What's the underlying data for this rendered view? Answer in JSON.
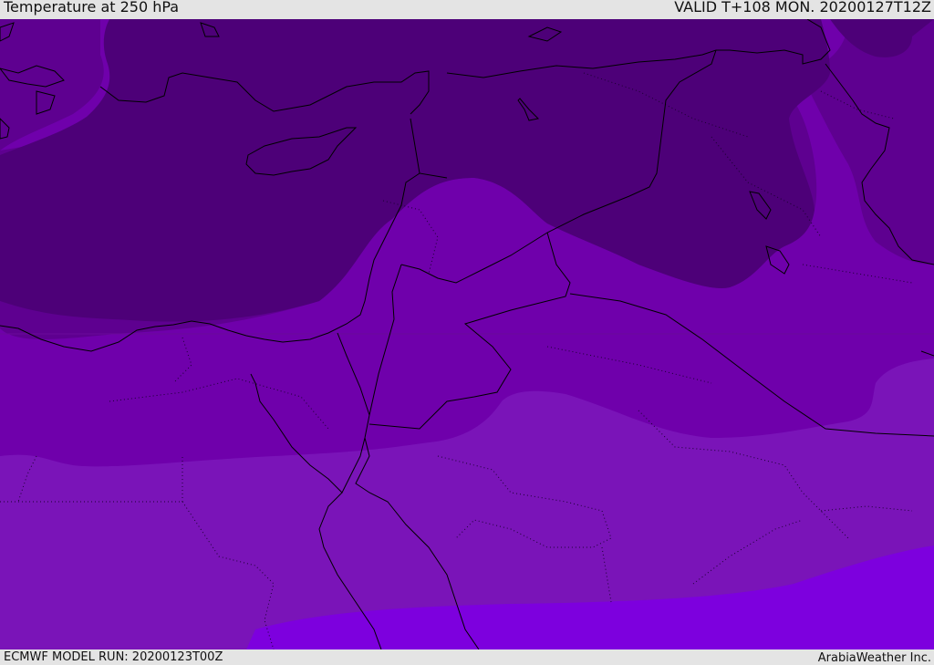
{
  "header": {
    "title": "Temperature at 250 hPa",
    "valid": "VALID T+108 MON. 20200127T12Z"
  },
  "footer": {
    "model_run": "ECMWF MODEL RUN: 20200123T00Z",
    "credit": "ArabiaWeather Inc."
  },
  "colors": {
    "band_coldest": "#4d0078",
    "band_cold": "#5e0090",
    "band_mid": "#6f00ab",
    "band_warm": "#7a14b8",
    "band_warmest": "#7d00de",
    "coast_line": "#000000"
  }
}
